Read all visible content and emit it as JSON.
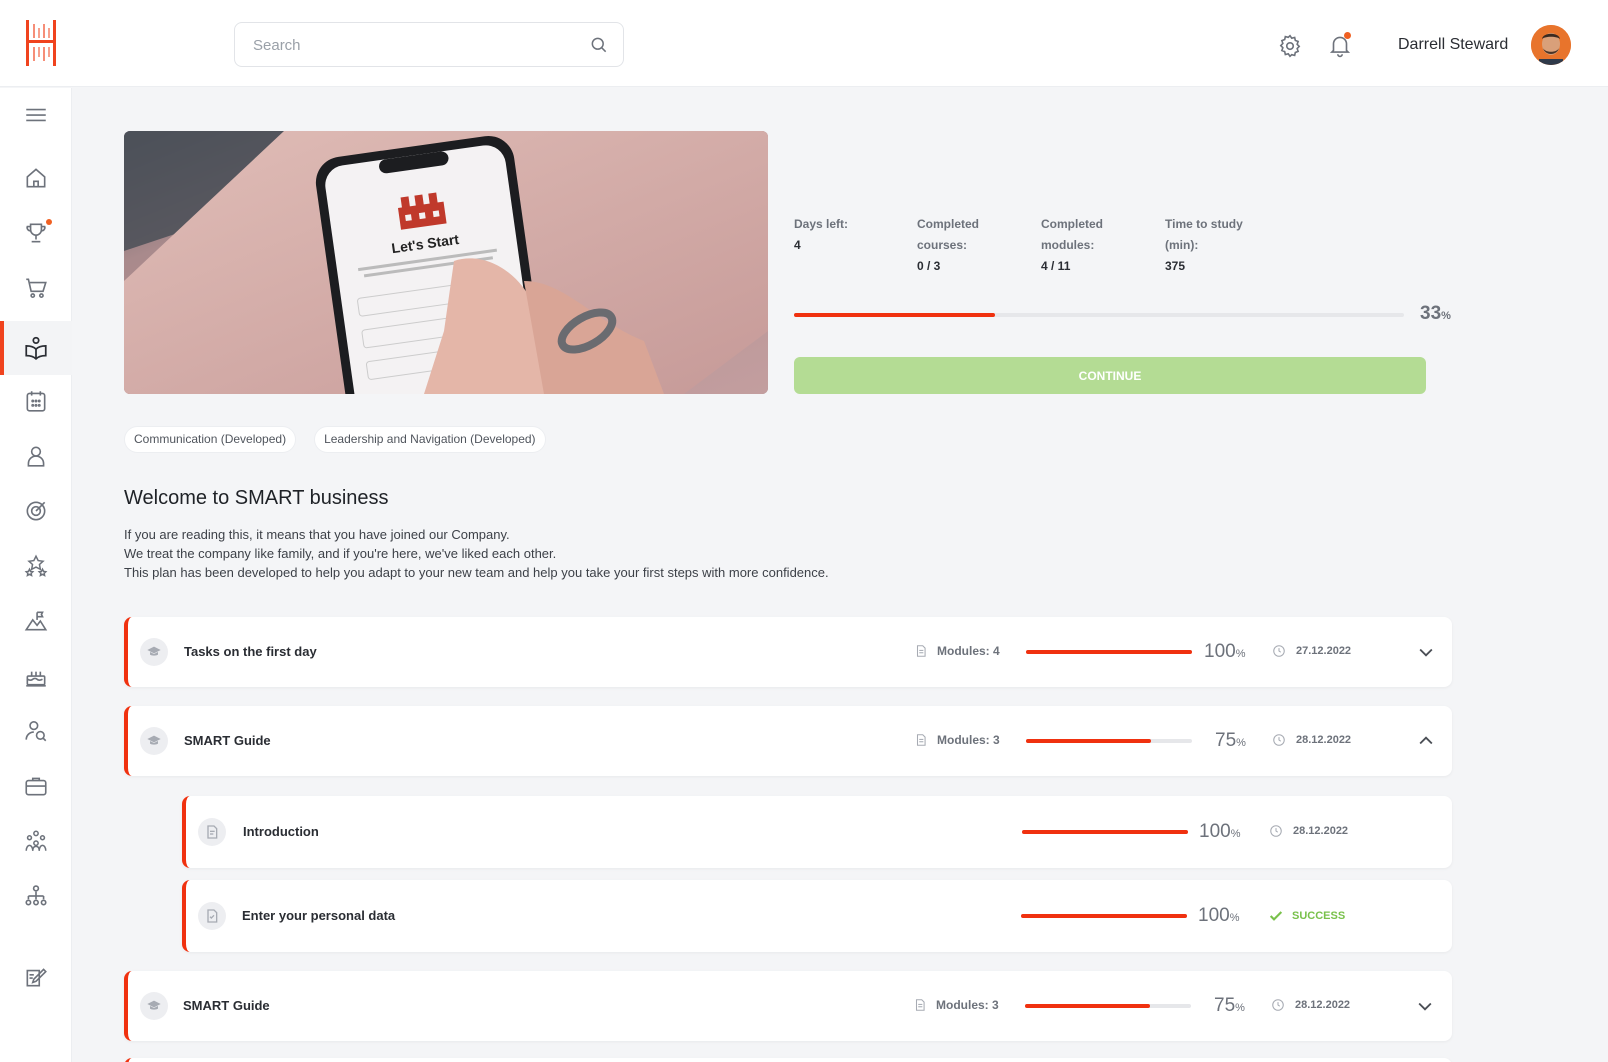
{
  "header": {
    "search_placeholder": "Search",
    "user_name": "Darrell Steward"
  },
  "sidebar": {
    "items": [
      {
        "icon": "menu-icon"
      },
      {
        "icon": "home-icon"
      },
      {
        "icon": "trophy-icon",
        "has_dot": true
      },
      {
        "icon": "cart-icon"
      },
      {
        "icon": "book-reader-icon",
        "active": true
      },
      {
        "icon": "calendar-icon"
      },
      {
        "icon": "user-icon"
      },
      {
        "icon": "target-icon"
      },
      {
        "icon": "stars-icon"
      },
      {
        "icon": "mountain-flag-icon"
      },
      {
        "icon": "cake-icon"
      },
      {
        "icon": "person-search-icon"
      },
      {
        "icon": "briefcase-icon"
      },
      {
        "icon": "team-icon"
      },
      {
        "icon": "org-chart-icon"
      },
      {
        "icon": "edit-note-icon"
      }
    ]
  },
  "hero": {
    "image_text": "Let's Start"
  },
  "stats": {
    "days_left_label": "Days left:",
    "days_left_value": "4",
    "courses_label_1": "Completed",
    "courses_label_2": "courses:",
    "courses_value": "0 / 3",
    "modules_label_1": "Completed",
    "modules_label_2": "modules:",
    "modules_value": "4 / 11",
    "time_label_1": "Time to study",
    "time_label_2": "(min):",
    "time_value": "375"
  },
  "progress": {
    "value": "33",
    "unit": "%",
    "fraction": 0.33
  },
  "continue_label": "CONTINUE",
  "tags": [
    "Communication (Developed)",
    "Leadership and Navigation (Developed)"
  ],
  "welcome": {
    "title": "Welcome to SMART business",
    "line1": "If you are reading this, it means that you have joined our Company.",
    "line2": "We treat the company like family, and if you're here, we've liked each other.",
    "line3": "This plan has been developed to help you adapt to your new team and help you take your first steps with more confidence."
  },
  "courses": [
    {
      "title": "Tasks on the first day",
      "modules": "Modules: 4",
      "pct": "100",
      "unit": "%",
      "fraction": 1.0,
      "date": "27.12.2022",
      "expanded": false
    },
    {
      "title": "SMART Guide",
      "modules": "Modules: 3",
      "pct": "75",
      "unit": "%",
      "fraction": 0.75,
      "date": "28.12.2022",
      "expanded": true,
      "children": [
        {
          "title": "Introduction",
          "pct": "100",
          "unit": "%",
          "fraction": 1.0,
          "date": "28.12.2022"
        },
        {
          "title": "Enter your personal data",
          "pct": "100",
          "unit": "%",
          "fraction": 1.0,
          "status": "SUCCESS"
        }
      ]
    },
    {
      "title": "SMART Guide",
      "modules": "Modules: 3",
      "pct": "75",
      "unit": "%",
      "fraction": 0.75,
      "date": "28.12.2022",
      "expanded": false
    }
  ],
  "colors": {
    "accent": "#f0310f",
    "success": "#79c14b",
    "continue_bg": "#b4dc94"
  }
}
